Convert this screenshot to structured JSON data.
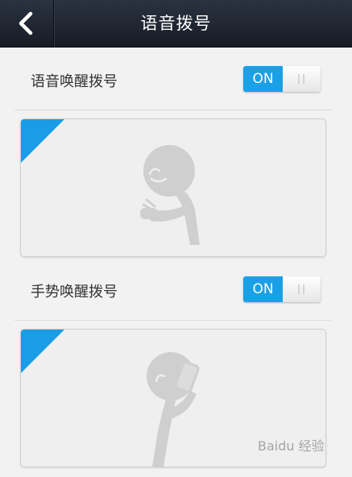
{
  "header": {
    "title": "语音拨号"
  },
  "settings": [
    {
      "label": "语音唤醒拨号",
      "toggle_on_text": "ON",
      "enabled": true
    },
    {
      "label": "手势唤醒拨号",
      "toggle_on_text": "ON",
      "enabled": true
    }
  ],
  "watermark": "Baidu 经验",
  "colors": {
    "accent": "#1aa0e6",
    "header_bg": "#1e2430",
    "page_bg": "#f2f2f2"
  },
  "icons": [
    "back-arrow-icon",
    "voice-gesture-illustration",
    "phone-gesture-illustration"
  ]
}
